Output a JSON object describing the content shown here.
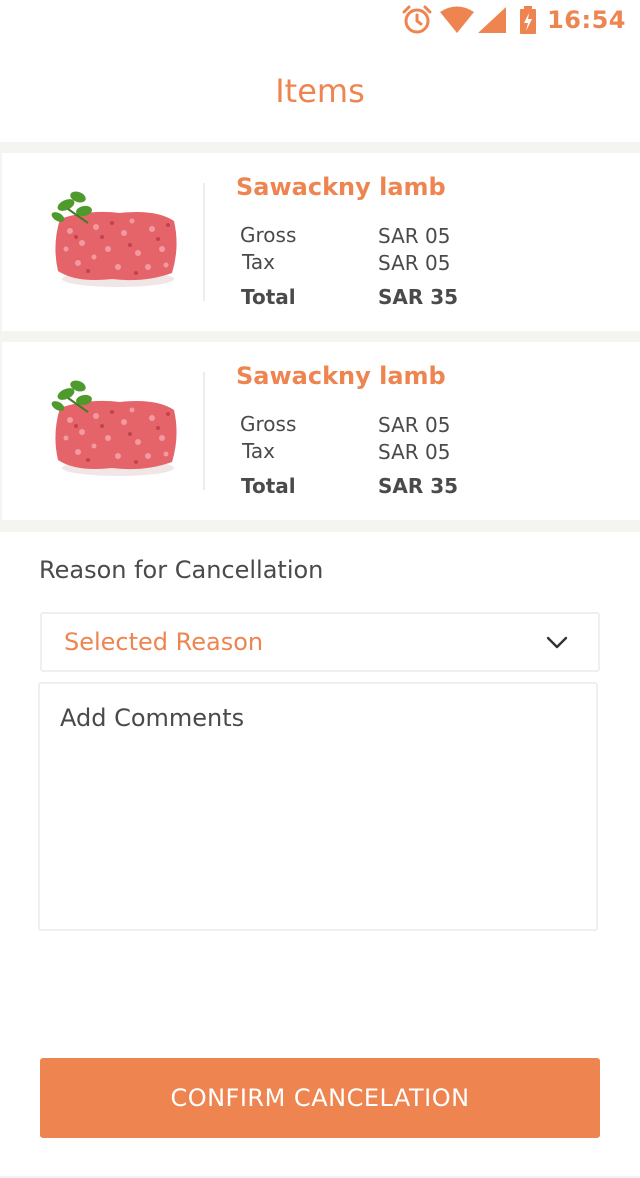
{
  "status_bar": {
    "time": "16:54",
    "icons": [
      "alarm-icon",
      "wifi-icon",
      "signal-icon",
      "battery-charging-icon"
    ]
  },
  "header": {
    "title": "Items"
  },
  "items": [
    {
      "name": "Sawackny lamb",
      "image": "minced-lamb-image",
      "gross_label": "Gross",
      "gross_value": "SAR 05",
      "tax_label": "Tax",
      "tax_value": "SAR 05",
      "total_label": "Total",
      "total_value": "SAR 35"
    },
    {
      "name": "Sawackny lamb",
      "image": "minced-lamb-image",
      "gross_label": "Gross",
      "gross_value": "SAR 05",
      "tax_label": "Tax",
      "tax_value": "SAR 05",
      "total_label": "Total",
      "total_value": "SAR 35"
    }
  ],
  "cancellation": {
    "label": "Reason for Cancellation",
    "selected_reason": "Selected Reason",
    "comments_placeholder": "Add Comments"
  },
  "confirm_button": {
    "label": "CONFIRM CANCELATION"
  },
  "colors": {
    "accent": "#ee8551",
    "text": "#4a4a4a",
    "band": "#f4f4f0"
  }
}
